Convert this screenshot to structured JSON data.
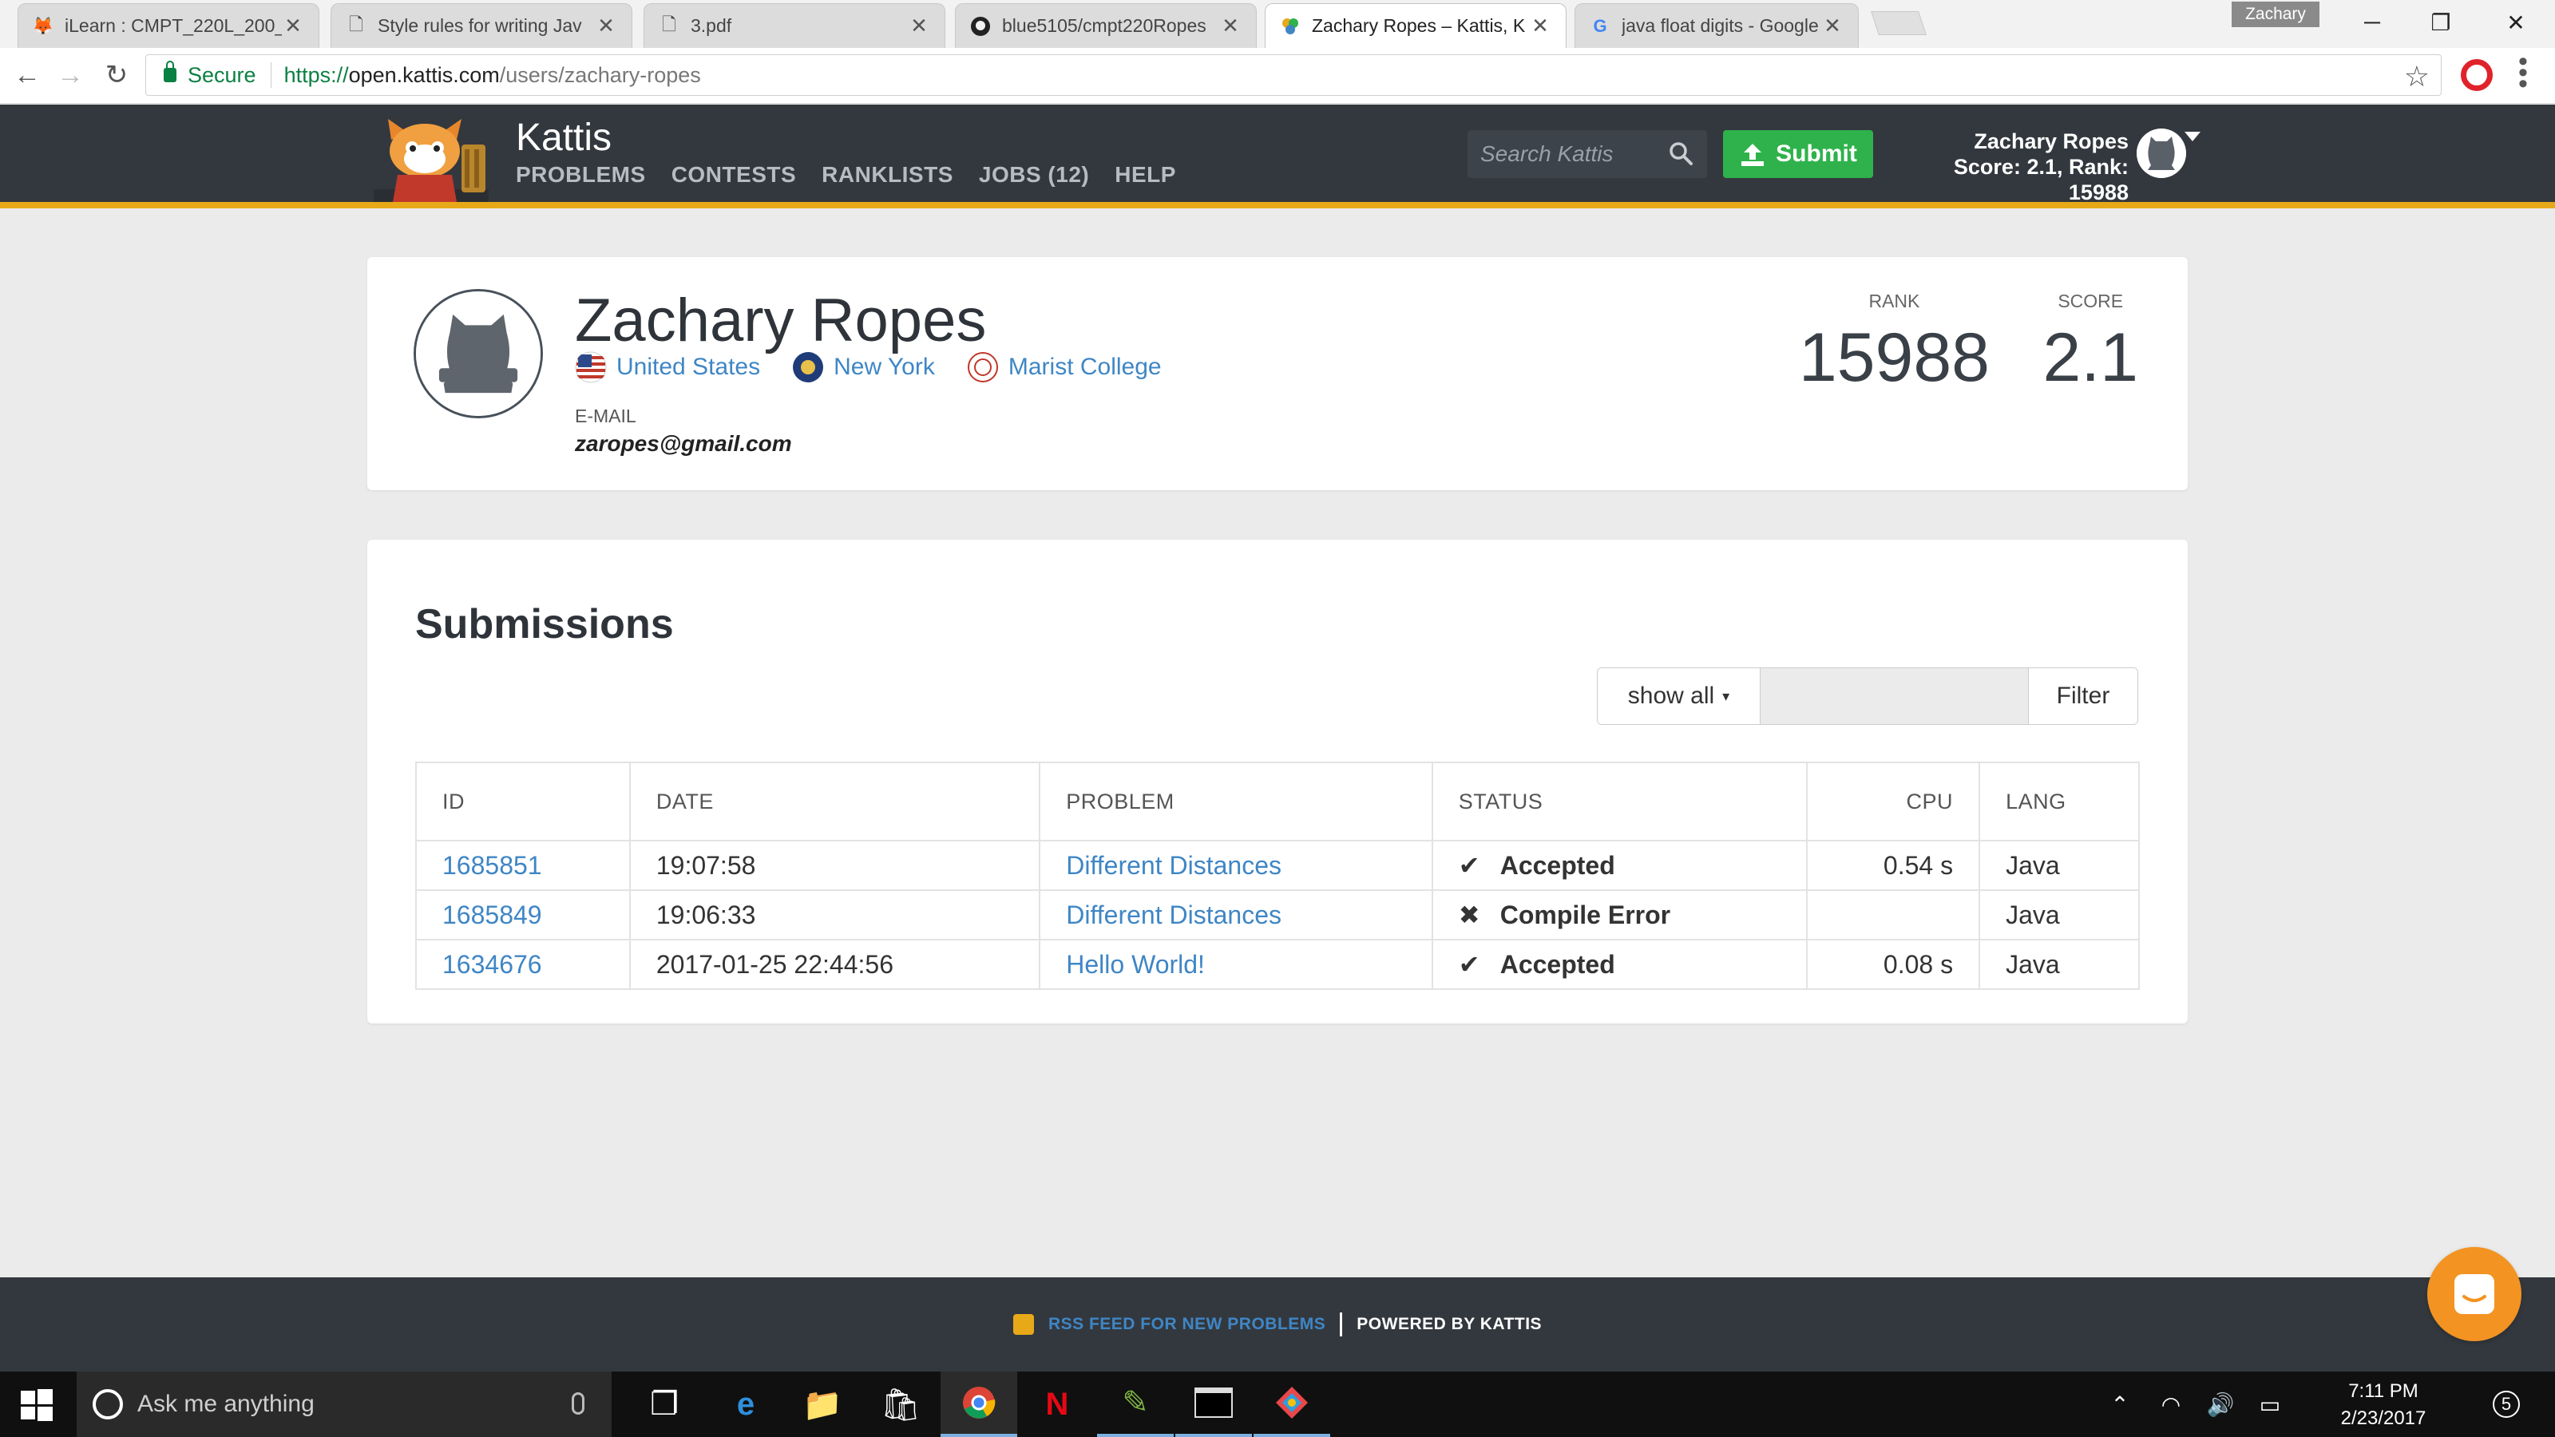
{
  "browser": {
    "tabs": [
      {
        "title": "iLearn : CMPT_220L_200_",
        "icon": "fox-favicon-icon"
      },
      {
        "title": "Style rules for writing Jav",
        "icon": "page-icon"
      },
      {
        "title": "3.pdf",
        "icon": "page-icon"
      },
      {
        "title": "blue5105/cmpt220Ropes",
        "icon": "github-icon"
      },
      {
        "title": "Zachary Ropes – Kattis, K",
        "icon": "kattis-icon"
      },
      {
        "title": "java float digits - Google",
        "icon": "google-icon"
      }
    ],
    "profile_name": "Zachary",
    "secure_label": "Secure",
    "url_scheme": "https://",
    "url_host": "open.kattis.com",
    "url_path": "/users/zachary-ropes"
  },
  "kattis": {
    "brand": "Kattis",
    "nav": [
      "PROBLEMS",
      "CONTESTS",
      "RANKLISTS",
      "JOBS (12)",
      "HELP"
    ],
    "search_placeholder": "Search Kattis",
    "submit_label": "Submit",
    "user_name": "Zachary Ropes",
    "user_stats": "Score: 2.1, Rank: 15988"
  },
  "profile": {
    "name": "Zachary Ropes",
    "country": "United States",
    "region": "New York",
    "school": "Marist College",
    "email_label": "E-MAIL",
    "email": "zaropes@gmail.com",
    "rank_label": "RANK",
    "rank": "15988",
    "score_label": "SCORE",
    "score": "2.1"
  },
  "submissions": {
    "title": "Submissions",
    "filter_select": "show all",
    "filter_button": "Filter",
    "columns": [
      "ID",
      "DATE",
      "PROBLEM",
      "STATUS",
      "CPU",
      "LANG"
    ],
    "rows": [
      {
        "id": "1685851",
        "date": "19:07:58",
        "problem": "Different Distances",
        "status": "Accepted",
        "status_icon": "✔",
        "cpu": "0.54 s",
        "lang": "Java"
      },
      {
        "id": "1685849",
        "date": "19:06:33",
        "problem": "Different Distances",
        "status": "Compile Error",
        "status_icon": "✖",
        "cpu": "",
        "lang": "Java"
      },
      {
        "id": "1634676",
        "date": "2017-01-25 22:44:56",
        "problem": "Hello World!",
        "status": "Accepted",
        "status_icon": "✔",
        "cpu": "0.08 s",
        "lang": "Java"
      }
    ]
  },
  "footer": {
    "rss": "RSS FEED FOR NEW PROBLEMS",
    "powered": "POWERED BY KATTIS"
  },
  "taskbar": {
    "search_placeholder": "Ask me anything",
    "time": "7:11 PM",
    "date": "2/23/2017",
    "notifications": "5"
  },
  "colors": {
    "kattis_header": "#33383e",
    "kattis_accent": "#e8a919",
    "link": "#3f86c5",
    "accepted": "#2fb24b",
    "error": "#e8121b"
  }
}
